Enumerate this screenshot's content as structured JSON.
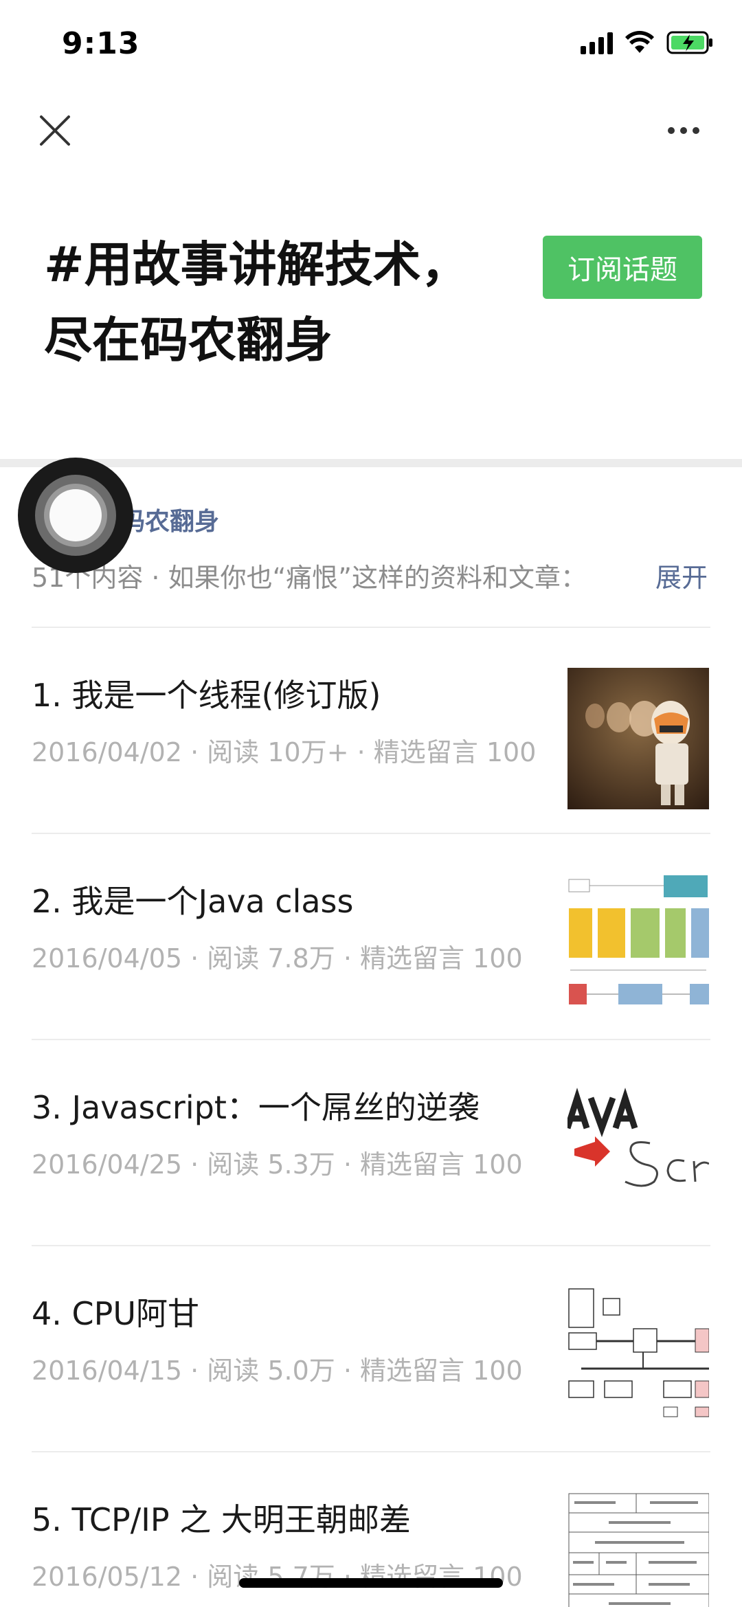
{
  "status_bar": {
    "time": "9:13"
  },
  "header": {
    "title": "#用故事讲解技术，尽在码农翻身",
    "subscribe_label": "订阅话题"
  },
  "account": {
    "name": "码农翻身",
    "summary": "51个内容 · 如果你也“痛恨”这样的资料和文章：",
    "expand_label": "展开"
  },
  "articles": [
    {
      "title": "1. 我是一个线程(修订版)",
      "meta": "2016/04/02 · 阅读 10万+ · 精选留言 100",
      "thumb": "lego-trooper-image"
    },
    {
      "title": "2. 我是一个Java class",
      "meta": "2016/04/05 · 阅读 7.8万 · 精选留言 100",
      "thumb": "jvm-diagram-image"
    },
    {
      "title": "3. Javascript：一个屌丝的逆袭",
      "meta": "2016/04/25 · 阅读 5.3万 · 精选留言 100",
      "thumb": "java-to-script-image"
    },
    {
      "title": "4. CPU阿甘",
      "meta": "2016/04/15 · 阅读 5.0万 · 精选留言 100",
      "thumb": "cpu-architecture-image"
    },
    {
      "title": "5. TCP/IP 之 大明王朝邮差",
      "meta": "2016/05/12 · 阅读 5.7万 · 精选留言 100",
      "thumb": "tcp-header-image"
    }
  ],
  "colors": {
    "accent_green": "#4fc264",
    "link_blue": "#576b95",
    "meta_gray": "#b2b2b2"
  }
}
